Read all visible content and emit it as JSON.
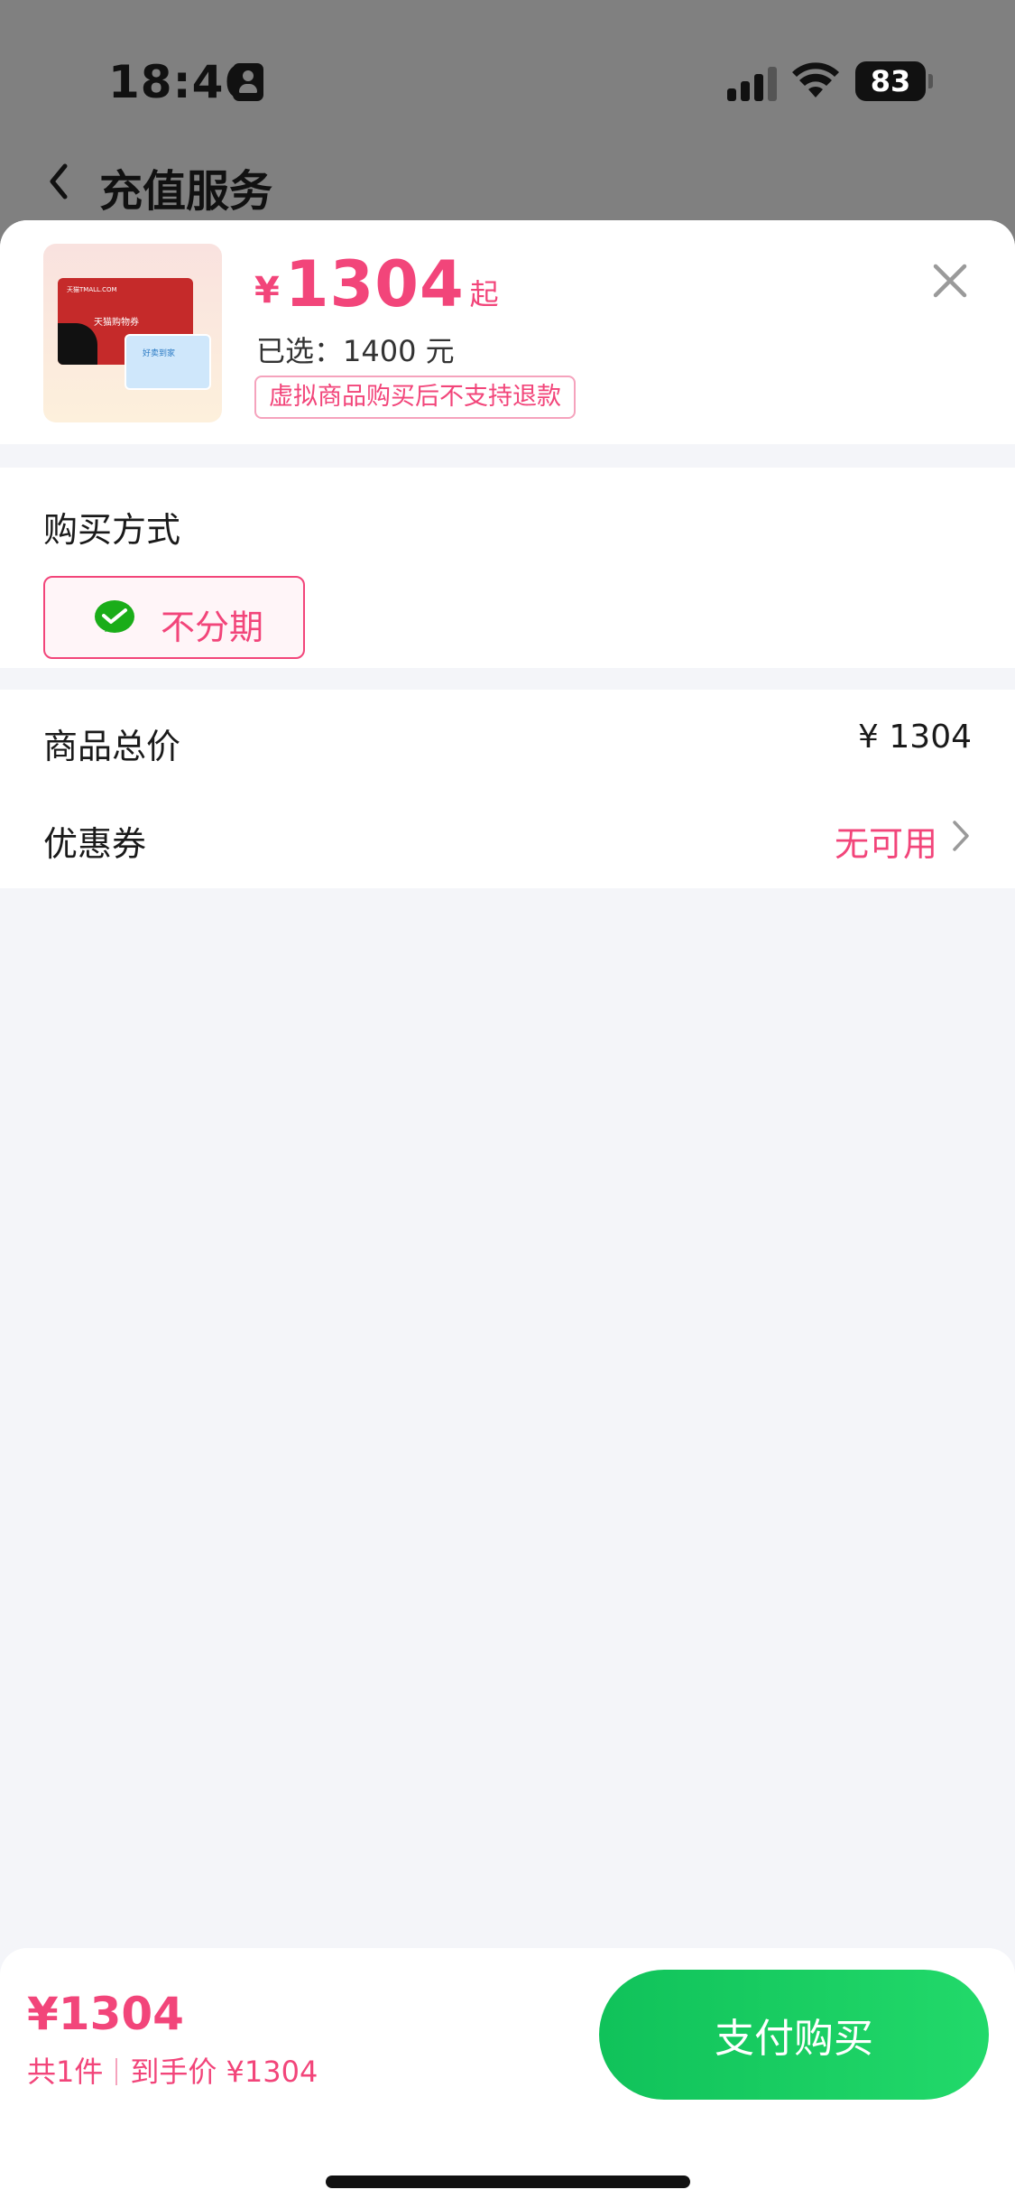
{
  "status_bar": {
    "time": "18:46",
    "battery": "83"
  },
  "nav": {
    "title": "充值服务"
  },
  "product": {
    "image_text": {
      "card_brand": "天猫TMALL.COM",
      "card_name": "天猫购物券",
      "small_card": "好卖到家"
    },
    "price_symbol": "¥",
    "price": "1304",
    "price_suffix": "起",
    "selected": "已选：1400 元",
    "refund_notice": "虚拟商品购买后不支持退款"
  },
  "payment": {
    "title": "购买方式",
    "option_label": "不分期"
  },
  "summary": {
    "total_label": "商品总价",
    "total_value": "¥ 1304",
    "coupon_label": "优惠券",
    "coupon_value": "无可用"
  },
  "bottom": {
    "price": "¥1304",
    "count": "共1件",
    "final": "到手价 ¥1304",
    "pay_button": "支付购买"
  },
  "colors": {
    "accent": "#f2457a",
    "pay_green": "#1acb62",
    "page_bg": "#f4f5f9"
  }
}
